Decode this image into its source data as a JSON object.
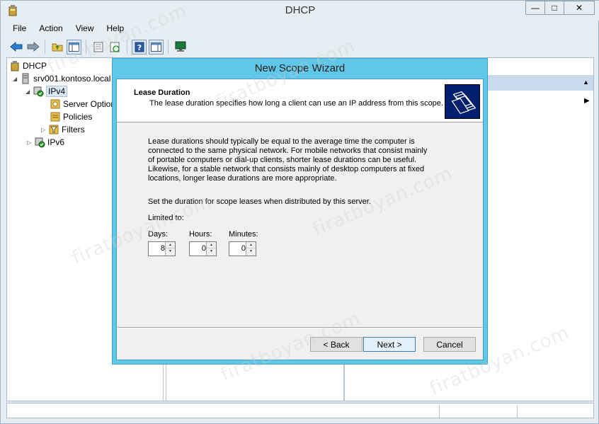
{
  "window": {
    "title": "DHCP",
    "minimize": "—",
    "maximize": "□",
    "close": "✕"
  },
  "menu": [
    "File",
    "Action",
    "View",
    "Help"
  ],
  "tree": {
    "root": "DHCP",
    "server": "srv001.kontoso.local",
    "ipv4": "IPv4",
    "server_options": "Server Options",
    "policies": "Policies",
    "filters": "Filters",
    "ipv6": "IPv6"
  },
  "wizard": {
    "title": "New Scope Wizard",
    "header_title": "Lease Duration",
    "header_subtitle": "The lease duration specifies how long a client can use an IP address from this scope.",
    "paragraph1": "Lease durations should typically be equal to the average time the computer is connected to the same physical network. For mobile networks that consist mainly of portable computers or dial-up clients, shorter lease durations can be useful. Likewise, for a stable network that consists mainly of desktop computers at fixed locations, longer lease durations are more appropriate.",
    "paragraph2": "Set the duration for scope leases when distributed by this server.",
    "limited_to": "Limited to:",
    "days_label": "Days:",
    "days_value": "8",
    "hours_label": "Hours:",
    "hours_value": "0",
    "minutes_label": "Minutes:",
    "minutes_value": "0",
    "back": "< Back",
    "next": "Next >",
    "cancel": "Cancel"
  },
  "watermark": "firatboyan.com"
}
